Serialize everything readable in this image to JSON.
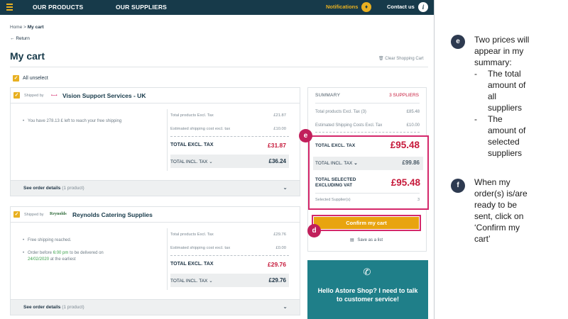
{
  "nav": {
    "products": "OUR PRODUCTS",
    "suppliers": "OUR SUPPLIERS",
    "notifications": "Notifications",
    "contact": "Contact us",
    "info_glyph": "i"
  },
  "breadcrumb": {
    "home": "Home",
    "sep": ">",
    "current": "My cart"
  },
  "return_label": "Return",
  "page_title": "My cart",
  "clear_cart": "Clear Shopping Cart",
  "all_unselect": "All unselect",
  "suppliers": [
    {
      "shipped_by": "Shipped by",
      "logo_text": "•V•S•",
      "name": "Vision Support Services - UK",
      "notes": [
        "You have 278.13 £ left to reach your free shipping"
      ],
      "rows": {
        "products_label": "Total products Excl. Tax",
        "products_value": "£21.87",
        "shipping_label": "Estimated shipping cost excl. tax",
        "shipping_value": "£10.00",
        "excl_label": "TOTAL EXCL. TAX",
        "excl_value": "£31.87",
        "incl_label": "TOTAL INCL. TAX",
        "incl_value": "£36.24"
      },
      "details_label": "See order details",
      "details_count": "(1 product)"
    },
    {
      "shipped_by": "Shipped by",
      "logo_text": "Reynolds",
      "name": "Reynolds Catering Supplies",
      "notes": [
        "Free shipping reached.",
        "Order before",
        "6:00 pm",
        "to be delivered on",
        "24/02/2020",
        "at the earliest"
      ],
      "rows": {
        "products_label": "Total products Excl. Tax",
        "products_value": "£29.76",
        "shipping_label": "Estimated shipping cost excl. tax",
        "shipping_value": "£0.00",
        "excl_label": "TOTAL EXCL. TAX",
        "excl_value": "£29.76",
        "incl_label": "TOTAL INCL. TAX",
        "incl_value": "£29.76"
      },
      "details_label": "See order details",
      "details_count": "(1 product)"
    }
  ],
  "summary": {
    "heading": "SUMMARY",
    "count": "3 SUPPLIERS",
    "products_label": "Total products Excl. Tax (3)",
    "products_value": "£85.48",
    "shipping_label": "Estimated Shipping Costs Excl. Tax",
    "shipping_value": "£10.00",
    "excl_label": "TOTAL EXCL. TAX",
    "excl_value": "£95.48",
    "incl_label": "TOTAL INCL. TAX",
    "incl_value": "£99.86",
    "selected_label": "TOTAL SELECTED EXCLUDING VAT",
    "selected_value": "£95.48",
    "selected_suppliers_label": "Selected Supplier(s)",
    "selected_suppliers_value": "3",
    "confirm": "Confirm my cart",
    "save": "Save as a list"
  },
  "help": {
    "text": "Hello Astore Shop? I need to talk to customer service!"
  },
  "markers": {
    "e": "e",
    "d": "d",
    "f": "f"
  },
  "annotations": {
    "e_intro": "Two prices will appear in my summary:",
    "e_item1": "The total amount of all suppliers",
    "e_item2": "The amount of selected suppliers",
    "f_text": "When my order(s) is/are ready to be sent, click on ‘Confirm my cart’"
  },
  "colors": {
    "nav_bg": "#173a4a",
    "accent_yellow": "#e8b021",
    "price_red": "#c61a3b",
    "callout_pink": "#d4286b",
    "help_teal": "#1f7f89"
  }
}
